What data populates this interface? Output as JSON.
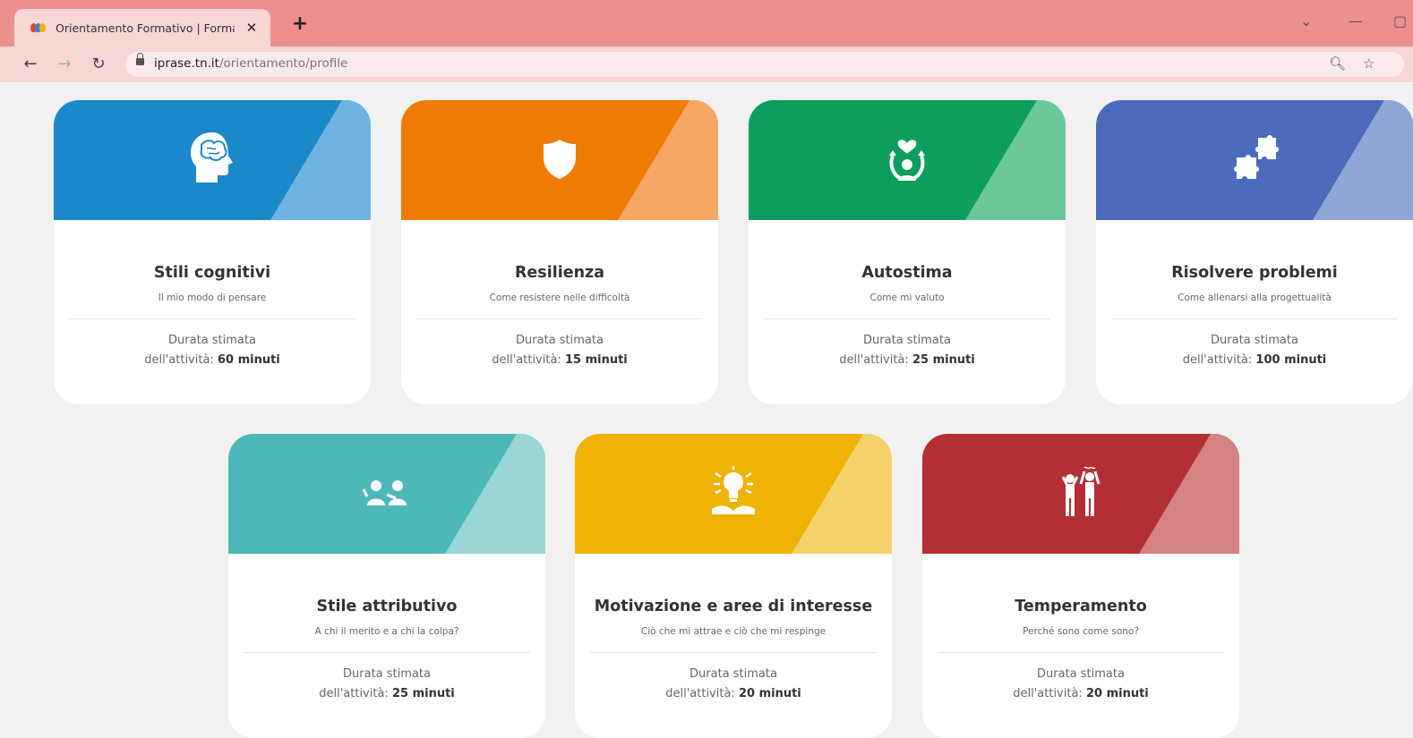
{
  "browser": {
    "tab_title": "Orientamento Formativo | Forma",
    "tab_close": "✕",
    "new_tab": "+",
    "url_host": "iprase.tn.it",
    "url_path": "/orientamento/profile"
  },
  "colors": {
    "tabbar": "#ee8f8f",
    "toolbar": "#f7d6d6",
    "page_bg": "#f1f1f1"
  },
  "cards": [
    {
      "title": "Stili cognitivi",
      "subtitle": "Il mio modo di pensare",
      "duration_label": "Durata stimata",
      "duration_prefix": "dell'attività:",
      "duration_value": "60 minuti",
      "icon": "brain-head-icon",
      "color": "#1a88c9",
      "color_light": "#6db5e0"
    },
    {
      "title": "Resilienza",
      "subtitle": "Come resistere nelle difficoltà",
      "duration_label": "Durata stimata",
      "duration_prefix": "dell'attività:",
      "duration_value": "15 minuti",
      "icon": "shield-icon",
      "color": "#f07b04",
      "color_light": "#f5a764"
    },
    {
      "title": "Autostima",
      "subtitle": "Come mi valuto",
      "duration_label": "Durata stimata",
      "duration_prefix": "dell'attività:",
      "duration_value": "25 minuti",
      "icon": "self-esteem-icon",
      "color": "#0c9e5c",
      "color_light": "#6cc79d"
    },
    {
      "title": "Risolvere problemi",
      "subtitle": "Come allenarsi alla progettualità",
      "duration_label": "Durata stimata",
      "duration_prefix": "dell'attività:",
      "duration_value": "100 minuti",
      "icon": "puzzle-icon",
      "color": "#4b6cbd",
      "color_light": "#8fa6d6"
    },
    {
      "title": "Stile attributivo",
      "subtitle": "A chi il merito e a chi la colpa?",
      "duration_label": "Durata stimata",
      "duration_prefix": "dell'attività:",
      "duration_value": "25 minuti",
      "icon": "people-pointing-icon",
      "color": "#4eb8b8",
      "color_light": "#9ad6d6"
    },
    {
      "title": "Motivazione e aree di interesse",
      "subtitle": "Ciò che mi attrae e ciò che mi respinge",
      "duration_label": "Durata stimata",
      "duration_prefix": "dell'attività:",
      "duration_value": "20 minuti",
      "icon": "lightbulb-book-icon",
      "color": "#eeb305",
      "color_light": "#f5d269"
    },
    {
      "title": "Temperamento",
      "subtitle": "Perché sono come sono?",
      "duration_label": "Durata stimata",
      "duration_prefix": "dell'attività:",
      "duration_value": "20 minuti",
      "icon": "temperament-people-icon",
      "color": "#b32f34",
      "color_light": "#d58285"
    }
  ]
}
